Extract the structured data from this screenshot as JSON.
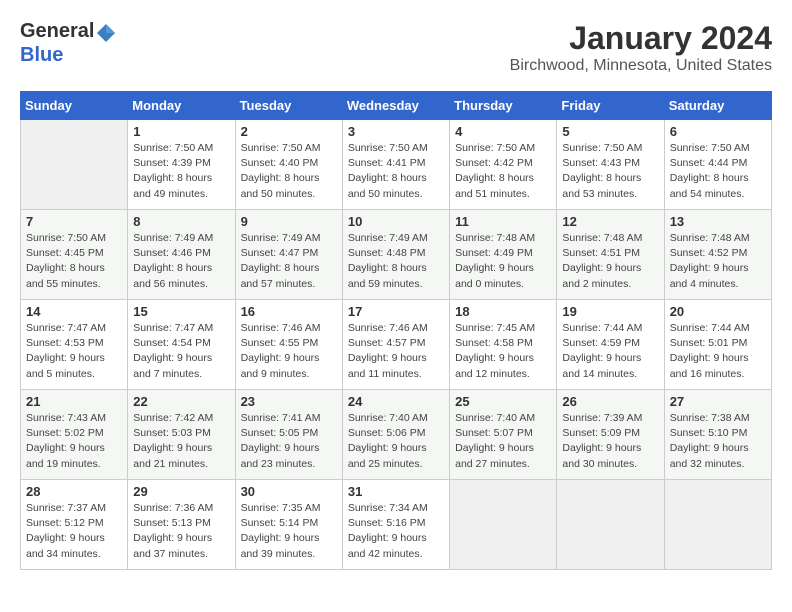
{
  "header": {
    "logo_general": "General",
    "logo_blue": "Blue",
    "month_year": "January 2024",
    "location": "Birchwood, Minnesota, United States"
  },
  "weekdays": [
    "Sunday",
    "Monday",
    "Tuesday",
    "Wednesday",
    "Thursday",
    "Friday",
    "Saturday"
  ],
  "weeks": [
    [
      {
        "day": "",
        "empty": true
      },
      {
        "day": "1",
        "sunrise": "7:50 AM",
        "sunset": "4:39 PM",
        "daylight": "8 hours and 49 minutes."
      },
      {
        "day": "2",
        "sunrise": "7:50 AM",
        "sunset": "4:40 PM",
        "daylight": "8 hours and 50 minutes."
      },
      {
        "day": "3",
        "sunrise": "7:50 AM",
        "sunset": "4:41 PM",
        "daylight": "8 hours and 50 minutes."
      },
      {
        "day": "4",
        "sunrise": "7:50 AM",
        "sunset": "4:42 PM",
        "daylight": "8 hours and 51 minutes."
      },
      {
        "day": "5",
        "sunrise": "7:50 AM",
        "sunset": "4:43 PM",
        "daylight": "8 hours and 53 minutes."
      },
      {
        "day": "6",
        "sunrise": "7:50 AM",
        "sunset": "4:44 PM",
        "daylight": "8 hours and 54 minutes."
      }
    ],
    [
      {
        "day": "7",
        "sunrise": "7:50 AM",
        "sunset": "4:45 PM",
        "daylight": "8 hours and 55 minutes."
      },
      {
        "day": "8",
        "sunrise": "7:49 AM",
        "sunset": "4:46 PM",
        "daylight": "8 hours and 56 minutes."
      },
      {
        "day": "9",
        "sunrise": "7:49 AM",
        "sunset": "4:47 PM",
        "daylight": "8 hours and 57 minutes."
      },
      {
        "day": "10",
        "sunrise": "7:49 AM",
        "sunset": "4:48 PM",
        "daylight": "8 hours and 59 minutes."
      },
      {
        "day": "11",
        "sunrise": "7:48 AM",
        "sunset": "4:49 PM",
        "daylight": "9 hours and 0 minutes."
      },
      {
        "day": "12",
        "sunrise": "7:48 AM",
        "sunset": "4:51 PM",
        "daylight": "9 hours and 2 minutes."
      },
      {
        "day": "13",
        "sunrise": "7:48 AM",
        "sunset": "4:52 PM",
        "daylight": "9 hours and 4 minutes."
      }
    ],
    [
      {
        "day": "14",
        "sunrise": "7:47 AM",
        "sunset": "4:53 PM",
        "daylight": "9 hours and 5 minutes."
      },
      {
        "day": "15",
        "sunrise": "7:47 AM",
        "sunset": "4:54 PM",
        "daylight": "9 hours and 7 minutes."
      },
      {
        "day": "16",
        "sunrise": "7:46 AM",
        "sunset": "4:55 PM",
        "daylight": "9 hours and 9 minutes."
      },
      {
        "day": "17",
        "sunrise": "7:46 AM",
        "sunset": "4:57 PM",
        "daylight": "9 hours and 11 minutes."
      },
      {
        "day": "18",
        "sunrise": "7:45 AM",
        "sunset": "4:58 PM",
        "daylight": "9 hours and 12 minutes."
      },
      {
        "day": "19",
        "sunrise": "7:44 AM",
        "sunset": "4:59 PM",
        "daylight": "9 hours and 14 minutes."
      },
      {
        "day": "20",
        "sunrise": "7:44 AM",
        "sunset": "5:01 PM",
        "daylight": "9 hours and 16 minutes."
      }
    ],
    [
      {
        "day": "21",
        "sunrise": "7:43 AM",
        "sunset": "5:02 PM",
        "daylight": "9 hours and 19 minutes."
      },
      {
        "day": "22",
        "sunrise": "7:42 AM",
        "sunset": "5:03 PM",
        "daylight": "9 hours and 21 minutes."
      },
      {
        "day": "23",
        "sunrise": "7:41 AM",
        "sunset": "5:05 PM",
        "daylight": "9 hours and 23 minutes."
      },
      {
        "day": "24",
        "sunrise": "7:40 AM",
        "sunset": "5:06 PM",
        "daylight": "9 hours and 25 minutes."
      },
      {
        "day": "25",
        "sunrise": "7:40 AM",
        "sunset": "5:07 PM",
        "daylight": "9 hours and 27 minutes."
      },
      {
        "day": "26",
        "sunrise": "7:39 AM",
        "sunset": "5:09 PM",
        "daylight": "9 hours and 30 minutes."
      },
      {
        "day": "27",
        "sunrise": "7:38 AM",
        "sunset": "5:10 PM",
        "daylight": "9 hours and 32 minutes."
      }
    ],
    [
      {
        "day": "28",
        "sunrise": "7:37 AM",
        "sunset": "5:12 PM",
        "daylight": "9 hours and 34 minutes."
      },
      {
        "day": "29",
        "sunrise": "7:36 AM",
        "sunset": "5:13 PM",
        "daylight": "9 hours and 37 minutes."
      },
      {
        "day": "30",
        "sunrise": "7:35 AM",
        "sunset": "5:14 PM",
        "daylight": "9 hours and 39 minutes."
      },
      {
        "day": "31",
        "sunrise": "7:34 AM",
        "sunset": "5:16 PM",
        "daylight": "9 hours and 42 minutes."
      },
      {
        "day": "",
        "empty": true
      },
      {
        "day": "",
        "empty": true
      },
      {
        "day": "",
        "empty": true
      }
    ]
  ],
  "labels": {
    "sunrise": "Sunrise:",
    "sunset": "Sunset:",
    "daylight": "Daylight:"
  }
}
